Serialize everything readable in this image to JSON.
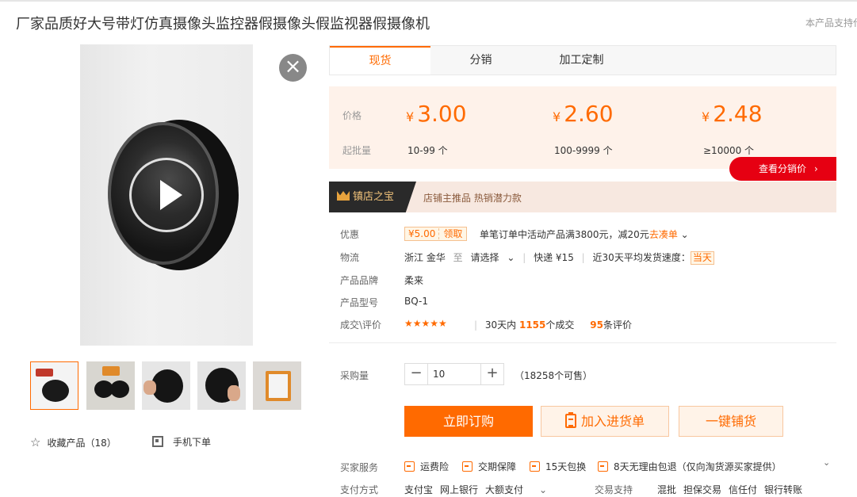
{
  "title": "厂家品质好大号带灯仿真摄像头监控器假摄像头假监视器假摄像机",
  "support_text": "本产品支持代发",
  "media": {
    "close_glyph": "×",
    "fav_label": "收藏产品（18）",
    "mobile_label": "手机下单"
  },
  "tabs": [
    {
      "label": "现货"
    },
    {
      "label": "分销"
    },
    {
      "label": "加工定制"
    }
  ],
  "price": {
    "price_label": "价格",
    "moq_label": "起批量",
    "currency": "¥",
    "tiers": [
      {
        "price": "3.00",
        "range": "10-99 个"
      },
      {
        "price": "2.60",
        "range": "100-9999 个"
      },
      {
        "price": "2.48",
        "range": "≥10000 个"
      }
    ],
    "dist_button": "查看分销价",
    "dist_arrow": "›"
  },
  "banner": {
    "badge": "镇店之宝",
    "text": "店铺主推品  热销潜力款"
  },
  "discount": {
    "label": "优惠",
    "coupon_amount": "¥5.00",
    "coupon_get": "领取",
    "text": "单笔订单中活动产品满3800元，减20元",
    "link": "去凑单",
    "chevron": "⌄"
  },
  "logistics": {
    "label": "物流",
    "from": "浙江 金华",
    "to_word": "至",
    "select": "请选择",
    "chevron": "⌄",
    "express": "快递 ¥15",
    "speed": "近30天平均发货速度：",
    "speed_badge": "当天"
  },
  "brand": {
    "label": "产品品牌",
    "value": "柔来"
  },
  "model": {
    "label": "产品型号",
    "value": "BQ-1"
  },
  "deals": {
    "label": "成交\\评价",
    "stars": "★★★★★",
    "period": "30天内",
    "count": "1155",
    "count_unit": "个成交",
    "reviews": "95",
    "reviews_unit": "条评价"
  },
  "purchase": {
    "label": "采购量",
    "minus": "−",
    "quantity": "10",
    "plus": "+",
    "available": "（18258个可售）"
  },
  "actions": {
    "order": "立即订购",
    "add_list": "加入进货单",
    "one_click": "一键铺货"
  },
  "services": {
    "label": "买家服务",
    "items": [
      "运费险",
      "交期保障",
      "15天包换",
      "8天无理由包退（仅向淘货源买家提供）"
    ],
    "chevron": "⌄"
  },
  "payment": {
    "label": "支付方式",
    "methods": [
      "支付宝",
      "网上银行",
      "大额支付"
    ],
    "chevron": "⌄",
    "trade_label": "交易支持",
    "trade": [
      "混批",
      "担保交易",
      "信任付",
      "银行转账"
    ]
  },
  "colors": {
    "accent": "#ff6a00",
    "red": "#e60012",
    "price_bg": "#fef2ea"
  }
}
